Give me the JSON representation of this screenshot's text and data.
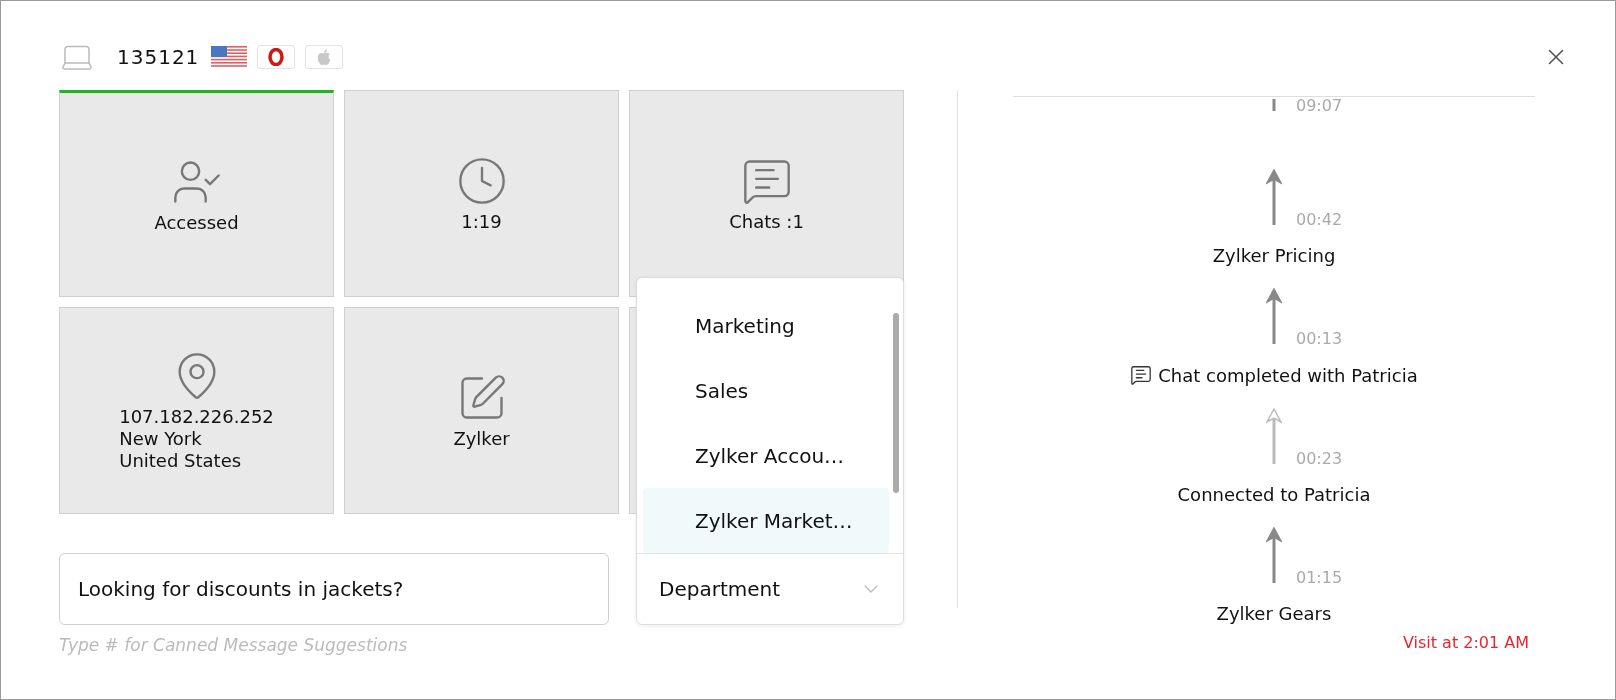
{
  "header": {
    "visitor_id": "135121"
  },
  "tiles": [
    {
      "kind": "user-check",
      "lines": [
        "Accessed"
      ],
      "selected": true
    },
    {
      "kind": "clock",
      "lines": [
        "1:19"
      ],
      "selected": false
    },
    {
      "kind": "chat",
      "lines": [
        "Chats :1"
      ],
      "selected": false
    },
    {
      "kind": "pin",
      "lines": [
        "107.182.226.252",
        "New York",
        "United States"
      ],
      "selected": false
    },
    {
      "kind": "edit",
      "lines": [
        "Zylker"
      ],
      "selected": false
    },
    {
      "kind": "empty",
      "selected": false
    }
  ],
  "message_field": {
    "value": "Looking for discounts in jackets?",
    "helper_text": "Type # for Canned Message Suggestions"
  },
  "department": {
    "label": "Department",
    "expanded": true,
    "options": [
      {
        "label": "Marketing",
        "selected": false
      },
      {
        "label": "Sales",
        "selected": false
      },
      {
        "label": "Zylker Accou…",
        "selected": false
      },
      {
        "label": "Zylker Market…",
        "selected": true
      }
    ]
  },
  "timeline": {
    "entries": [
      {
        "kind": "step",
        "time": "09:07",
        "partial": true,
        "faded": false
      },
      {
        "kind": "step",
        "time": "00:42",
        "partial": false,
        "faded": false
      },
      {
        "kind": "event",
        "label": "Zylker Pricing"
      },
      {
        "kind": "step",
        "time": "00:13",
        "partial": false,
        "faded": false
      },
      {
        "kind": "chat-event",
        "label": "Chat completed with Patricia"
      },
      {
        "kind": "step",
        "time": "00:23",
        "partial": false,
        "faded": true
      },
      {
        "kind": "event",
        "label": "Connected to Patricia"
      },
      {
        "kind": "step",
        "time": "01:15",
        "partial": false,
        "faded": false
      },
      {
        "kind": "event",
        "label": "Zylker Gears"
      }
    ],
    "footer": "Visit at 2:01 AM"
  }
}
